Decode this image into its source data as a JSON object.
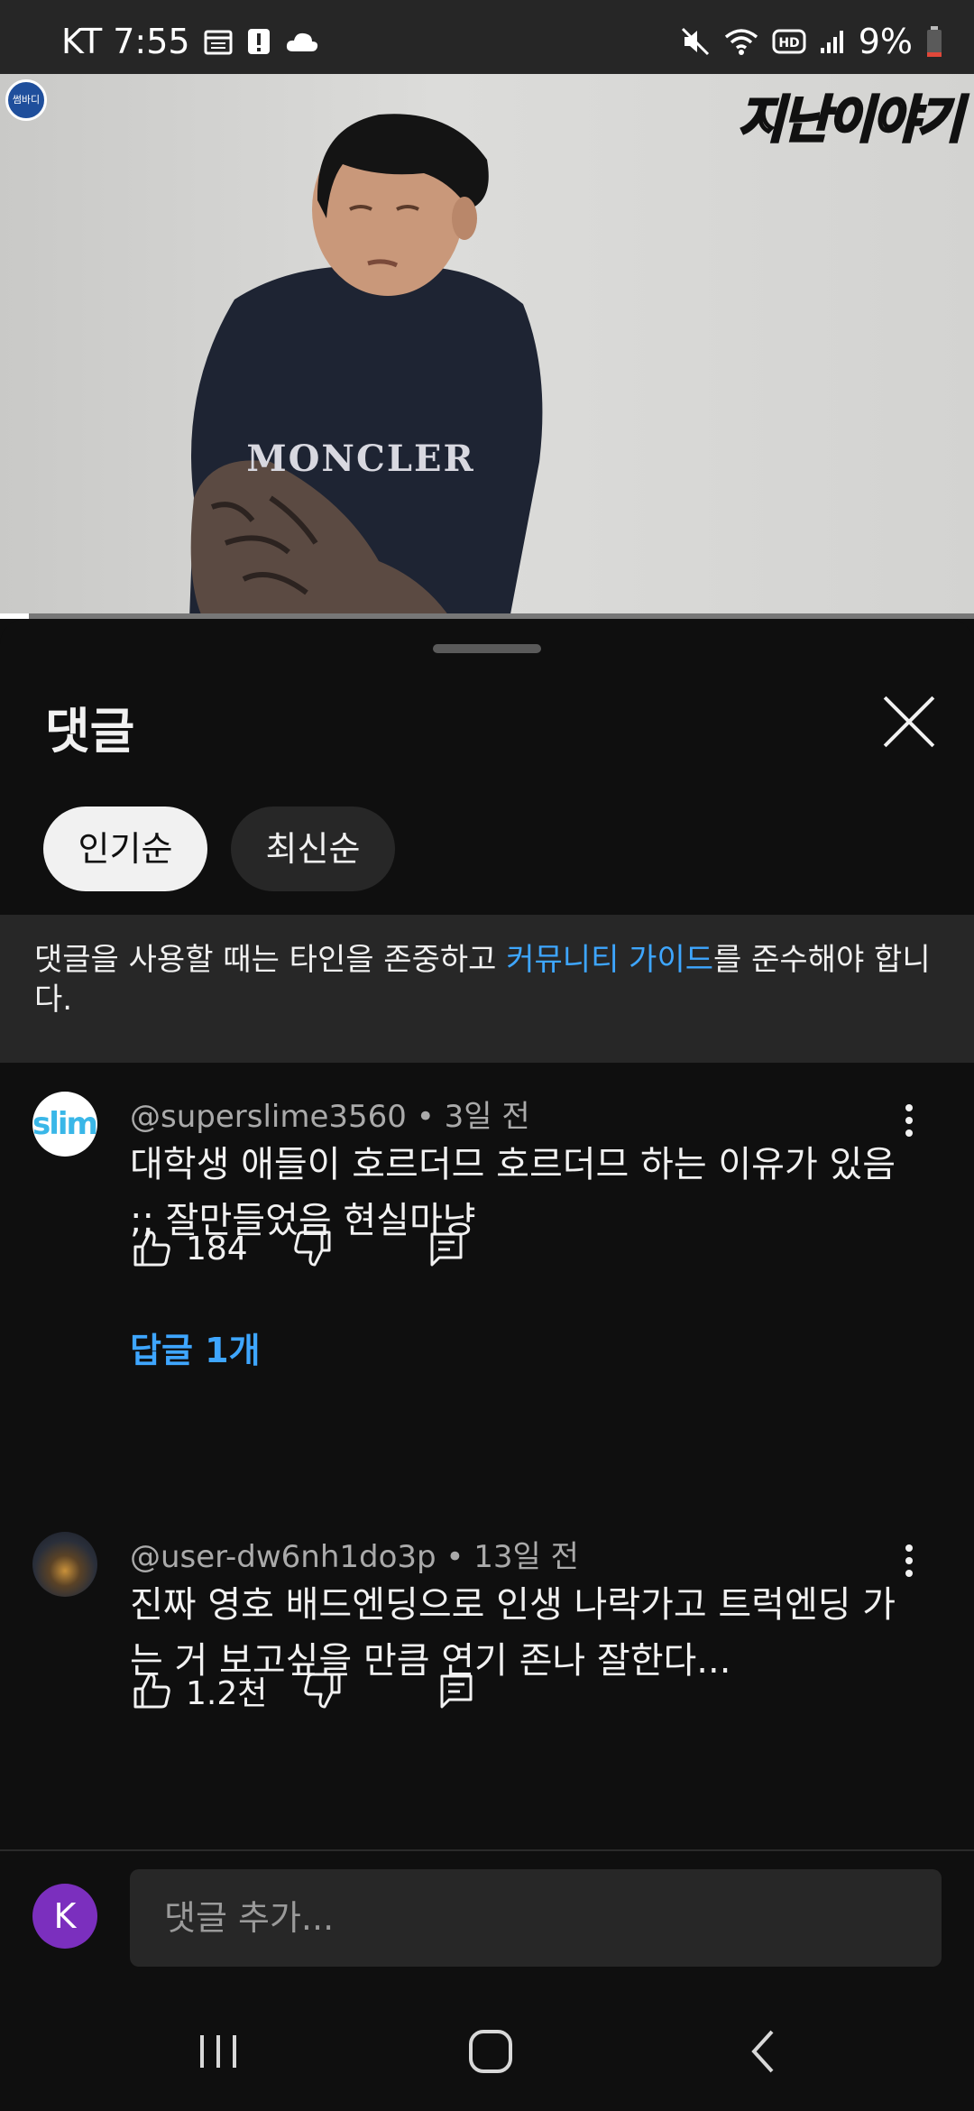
{
  "status_bar": {
    "carrier_time": "KT 7:55",
    "battery": "9%",
    "left_icons": [
      "calendar-icon",
      "alert-icon",
      "cloud-icon"
    ],
    "right_icons": [
      "mute-icon",
      "wifi-icon",
      "hd-icon",
      "signal-icon",
      "battery-icon"
    ]
  },
  "video": {
    "watermark": "지난이야기",
    "channel_badge": "썸바디",
    "progress": 0.03
  },
  "sheet": {
    "title": "댓글",
    "sort_chips": [
      {
        "label": "인기순",
        "active": true
      },
      {
        "label": "최신순",
        "active": false
      }
    ],
    "guideline": {
      "before": "댓글을 사용할 때는 타인을 존중하고 ",
      "link": "커뮤니티 가이드",
      "after": "를 준수해야 합니다."
    }
  },
  "comments": [
    {
      "avatar_text": "slime",
      "author": "@superslime3560",
      "time": "3일 전",
      "text": "대학생 애들이 호르더므 호르더므 하는 이유가 있음 ;; 잘만들었음 현실마냥",
      "likes": "184",
      "replies": "답글 1개"
    },
    {
      "author": "@user-dw6nh1do3p",
      "time": "13일 전",
      "text": "진짜 영호 배드엔딩으로 인생 나락가고 트럭엔딩 가는 거 보고싶을 만큼 연기 존나 잘한다...",
      "likes": "1.2천"
    }
  ],
  "composer": {
    "user_initial": "K",
    "placeholder": "댓글 추가..."
  },
  "colors": {
    "background": "#0f0f0f",
    "link_blue": "#3ea6ff",
    "chip_inactive": "#272727",
    "user_avatar": "#7b2fbe"
  }
}
